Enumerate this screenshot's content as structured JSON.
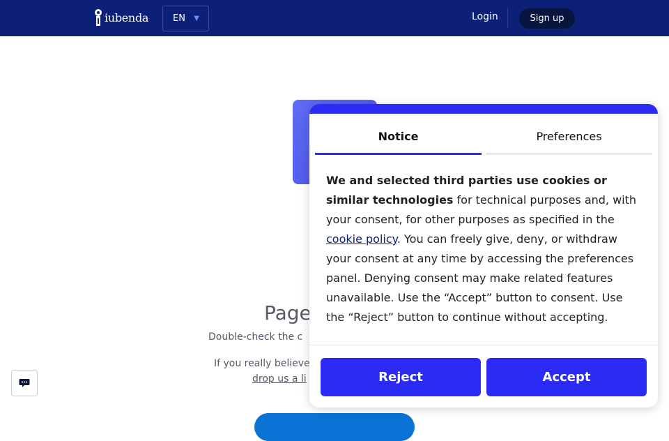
{
  "header": {
    "brand": "iubenda",
    "language": "EN",
    "login_label": "Login",
    "signup_label": "Sign up"
  },
  "page": {
    "title": "Page",
    "subtitle": "Double-check the c",
    "hint": "If you really believe",
    "link_text": "drop us a li"
  },
  "consent": {
    "tabs": [
      {
        "label": "Notice",
        "active": true
      },
      {
        "label": "Preferences",
        "active": false
      }
    ],
    "text_bold": "We and selected third parties use cookies or similar technologies",
    "text_part1": " for technical purposes and, with your consent, for other purposes as specified in the ",
    "link_label": "cookie policy",
    "text_part2": ". You can freely give, deny, or withdraw your consent at any time by accessing the preferences panel. Denying consent may make related features unavailable. Use the “Accept” button to consent. Use the “Reject” button to continue without accepting.",
    "reject_label": "Reject",
    "accept_label": "Accept"
  },
  "colors": {
    "header_bg": "#0b2076",
    "accent": "#2b2bf5",
    "cta_blue": "#0b73d6"
  },
  "icons": {
    "logo": "iubenda-logo-icon",
    "chevron": "chevron-down-icon",
    "chat": "chat-bubble-icon"
  }
}
